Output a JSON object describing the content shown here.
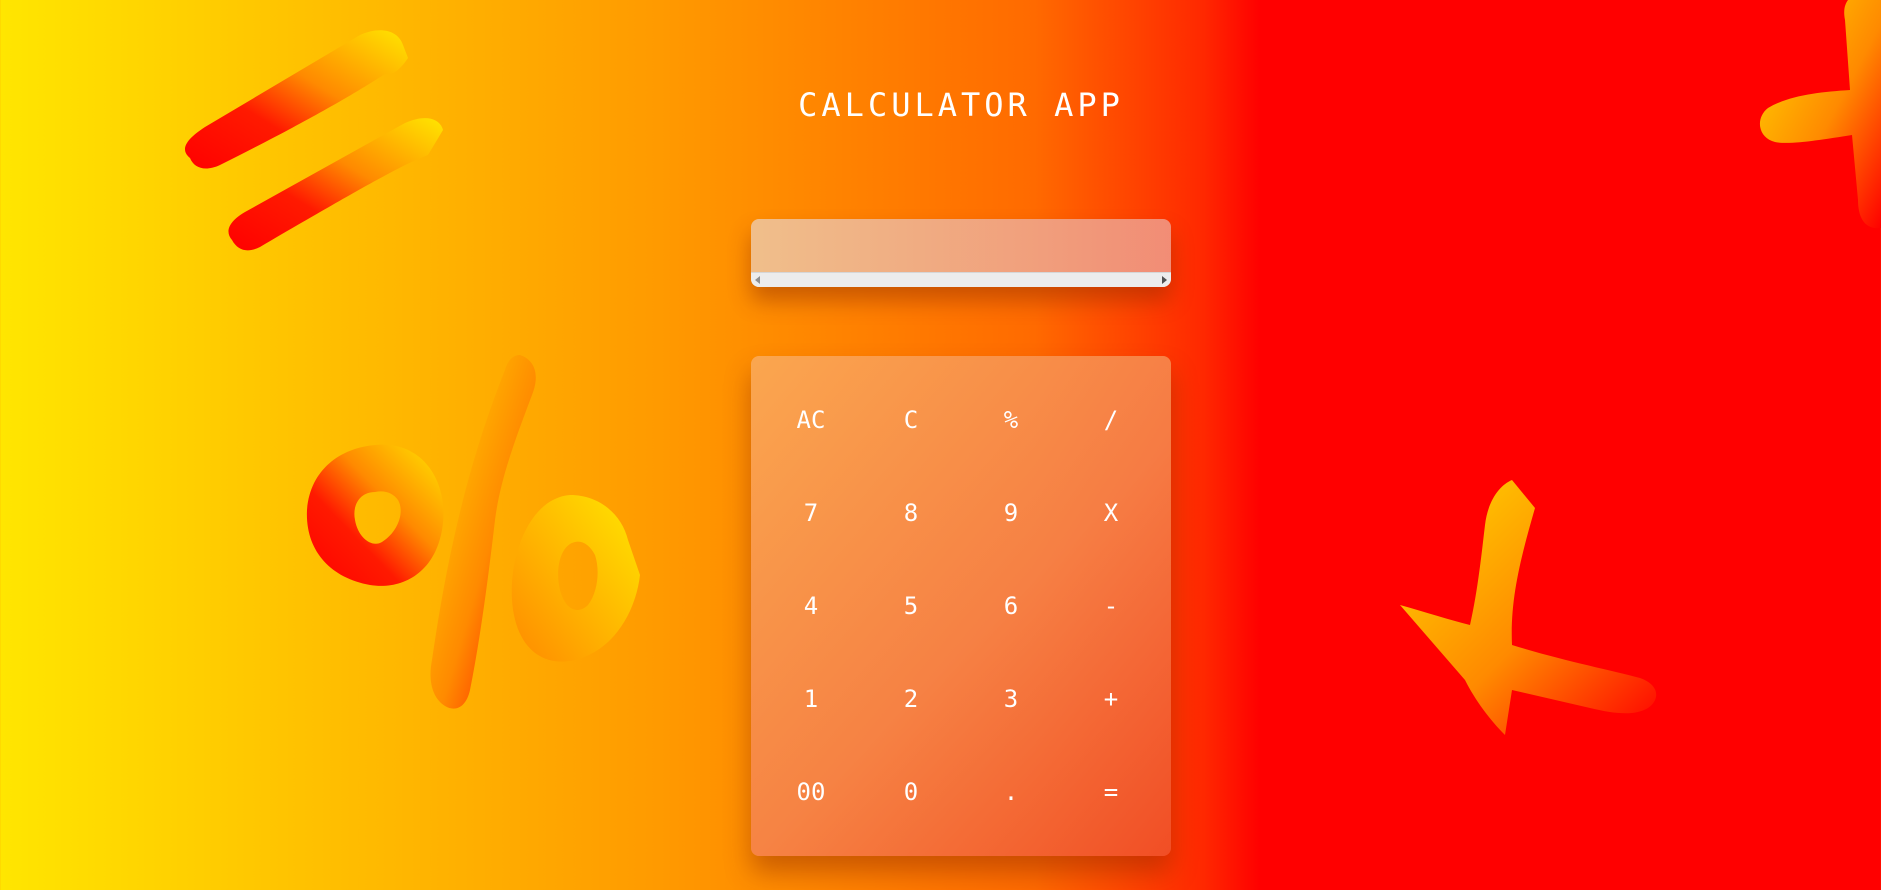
{
  "app": {
    "title": "CALCULATOR APP"
  },
  "display": {
    "value": ""
  },
  "keypad": {
    "keys": [
      "AC",
      "C",
      "%",
      "/",
      "7",
      "8",
      "9",
      "X",
      "4",
      "5",
      "6",
      "-",
      "1",
      "2",
      "3",
      "+",
      "00",
      "0",
      ".",
      "="
    ]
  },
  "decorations": {
    "symbols": [
      "equals-icon",
      "percent-icon",
      "plus-icon",
      "plus-icon"
    ],
    "colors": {
      "yellow": "#ffe600",
      "orange": "#ff8a00",
      "red": "#ff0000"
    }
  }
}
